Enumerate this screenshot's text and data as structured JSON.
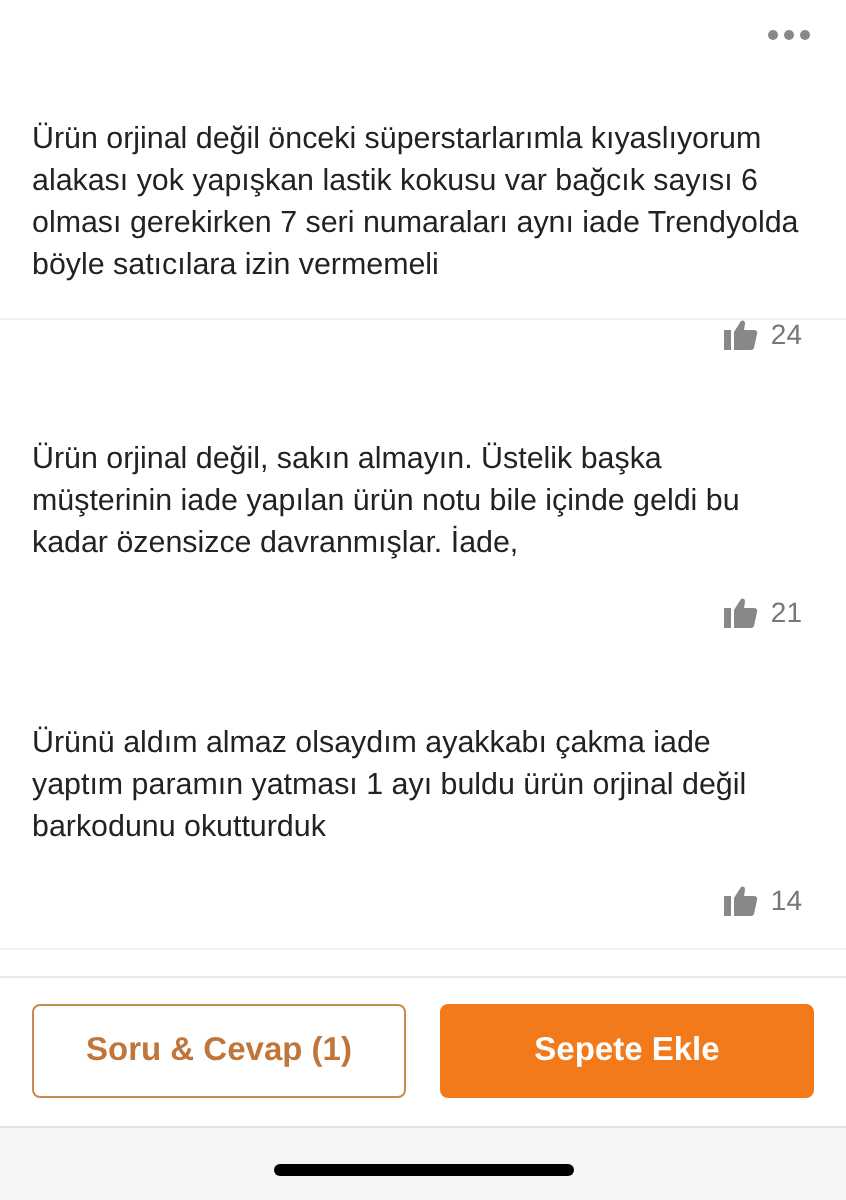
{
  "reviews": [
    {
      "text": "Ürün orjinal değil önceki süperstarlarımla kıyaslıyorum alakası yok yapışkan lastik kokusu var bağcık sayısı 6 olması gerekirken 7 seri numaraları aynı iade Trendyolda böyle satıcılara izin vermemeli",
      "likes": "24"
    },
    {
      "text": "Ürün orjinal değil, sakın almayın. Üstelik başka müşterinin iade yapılan ürün notu bile içinde geldi bu kadar özensizce davranmışlar. İade,",
      "likes": "21"
    },
    {
      "text": "Ürünü aldım almaz olsaydım ayakkabı çakma iade yaptım paramın yatması 1 ayı buldu ürün orjinal değil barkodunu okutturduk",
      "likes": "14"
    }
  ],
  "buttons": [
    {
      "label": "Soru & Cevap (1)",
      "kind": "outline"
    },
    {
      "label": "Sepete Ekle",
      "kind": "primary"
    }
  ]
}
